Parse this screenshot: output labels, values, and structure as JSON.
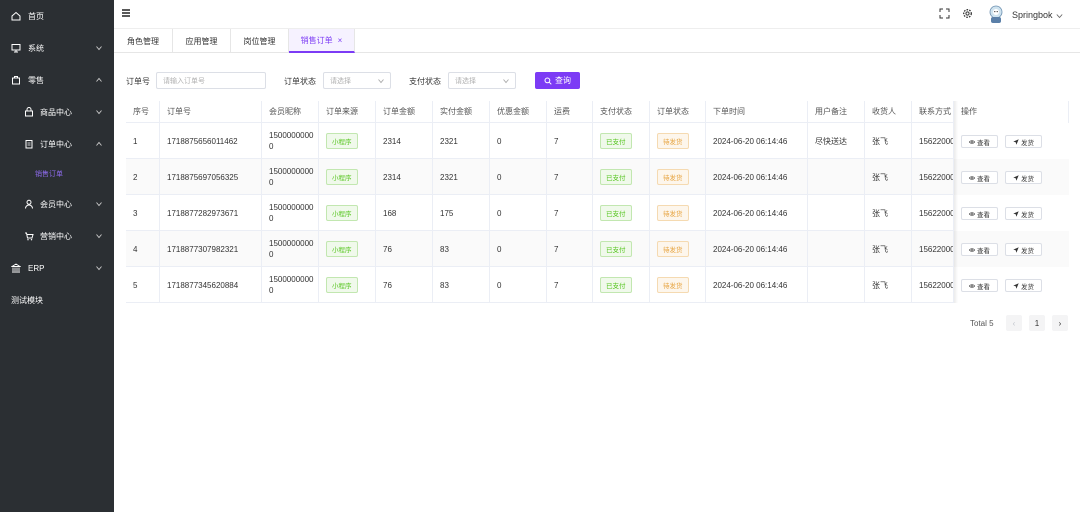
{
  "sidebar": {
    "items": [
      {
        "label": "首页",
        "icon": "home-icon"
      },
      {
        "label": "系统",
        "icon": "monitor-icon"
      },
      {
        "label": "零售",
        "icon": "bag-icon"
      },
      {
        "label": "商品中心",
        "icon": "lock-icon"
      },
      {
        "label": "订单中心",
        "icon": "clipboard-icon"
      },
      {
        "label": "销售订单",
        "icon": ""
      },
      {
        "label": "会员中心",
        "icon": "user-icon"
      },
      {
        "label": "营销中心",
        "icon": "cart-icon"
      },
      {
        "label": "ERP",
        "icon": "bank-icon"
      },
      {
        "label": "测试模块",
        "icon": ""
      }
    ],
    "active_color": "#8f6cf0"
  },
  "header": {
    "username": "Springbok"
  },
  "tabs": [
    {
      "label": "角色管理"
    },
    {
      "label": "应用管理"
    },
    {
      "label": "岗位管理"
    },
    {
      "label": "销售订单",
      "close": "×"
    }
  ],
  "filters": {
    "order_no_label": "订单号",
    "order_no_placeholder": "请输入订单号",
    "order_status_label": "订单状态",
    "order_status_placeholder": "请选择",
    "pay_status_label": "支付状态",
    "pay_status_placeholder": "请选择",
    "query_button": "查询"
  },
  "table": {
    "columns": [
      "序号",
      "订单号",
      "会员昵称",
      "订单来源",
      "订单金额",
      "实付金额",
      "优惠金额",
      "运费",
      "支付状态",
      "订单状态",
      "下单时间",
      "用户备注",
      "收货人",
      "联系方式",
      "操作"
    ],
    "view_label": "查看",
    "ship_label": "发货",
    "rows": [
      {
        "no": "1",
        "order_no": "1718875656011462",
        "member": "15000000000",
        "source": "小程序",
        "amount": "2314",
        "paid": "2321",
        "discount": "0",
        "freight": "7",
        "pay_status": "已支付",
        "order_status": "待发货",
        "time": "2024-06-20 06:14:46",
        "remark": "尽快送达",
        "receiver": "张飞",
        "phone": "15622000"
      },
      {
        "no": "2",
        "order_no": "1718875697056325",
        "member": "15000000000",
        "source": "小程序",
        "amount": "2314",
        "paid": "2321",
        "discount": "0",
        "freight": "7",
        "pay_status": "已支付",
        "order_status": "待发货",
        "time": "2024-06-20 06:14:46",
        "remark": "",
        "receiver": "张飞",
        "phone": "15622000"
      },
      {
        "no": "3",
        "order_no": "1718877282973671",
        "member": "15000000000",
        "source": "小程序",
        "amount": "168",
        "paid": "175",
        "discount": "0",
        "freight": "7",
        "pay_status": "已支付",
        "order_status": "待发货",
        "time": "2024-06-20 06:14:46",
        "remark": "",
        "receiver": "张飞",
        "phone": "15622000"
      },
      {
        "no": "4",
        "order_no": "1718877307982321",
        "member": "15000000000",
        "source": "小程序",
        "amount": "76",
        "paid": "83",
        "discount": "0",
        "freight": "7",
        "pay_status": "已支付",
        "order_status": "待发货",
        "time": "2024-06-20 06:14:46",
        "remark": "",
        "receiver": "张飞",
        "phone": "15622000"
      },
      {
        "no": "5",
        "order_no": "1718877345620884",
        "member": "15000000000",
        "source": "小程序",
        "amount": "76",
        "paid": "83",
        "discount": "0",
        "freight": "7",
        "pay_status": "已支付",
        "order_status": "待发货",
        "time": "2024-06-20 06:14:46",
        "remark": "",
        "receiver": "张飞",
        "phone": "15622000"
      }
    ]
  },
  "pagination": {
    "total": "Total 5",
    "prev": "‹",
    "page": "1",
    "next": "›"
  },
  "colors": {
    "primary": "#7c3bf5",
    "sidebar_bg": "#2b2f33"
  }
}
